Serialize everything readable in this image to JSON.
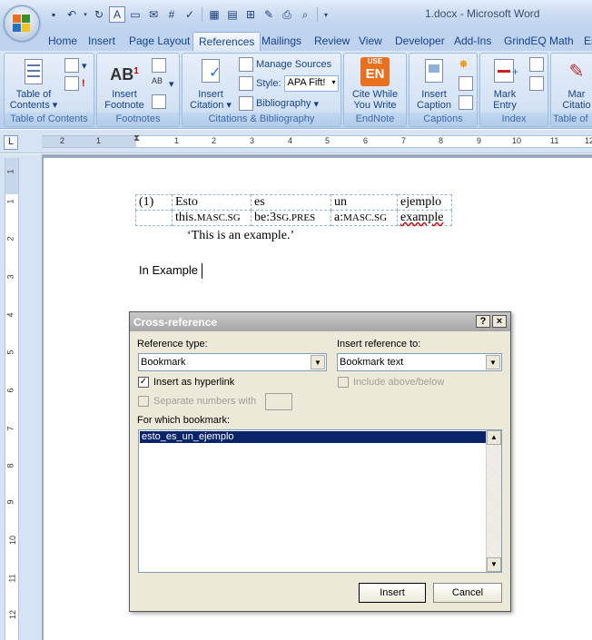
{
  "window": {
    "title": "1.docx - Microsoft Word"
  },
  "tabs": [
    "Home",
    "Insert",
    "Page Layout",
    "References",
    "Mailings",
    "Review",
    "View",
    "Developer",
    "Add-Ins",
    "GrindEQ Math",
    "En"
  ],
  "active_tab": "References",
  "ribbon": {
    "toc": {
      "button": "Table of Contents",
      "group": "Table of Contents"
    },
    "footnotes": {
      "button": "Insert Footnote",
      "group": "Footnotes"
    },
    "citations": {
      "insert_citation": "Insert Citation",
      "manage_sources": "Manage Sources",
      "style_label": "Style:",
      "style_value": "APA Fift!",
      "bibliography": "Bibliography",
      "group": "Citations & Bibliography"
    },
    "endnote": {
      "logo_top": "USE",
      "logo_bottom": "EN",
      "button": "Cite While You Write",
      "group": "EndNote"
    },
    "captions": {
      "button": "Insert Caption",
      "group": "Captions"
    },
    "index": {
      "button": "Mark Entry",
      "group": "Index"
    },
    "toa": {
      "button": "Mar Citatio",
      "group": "Table of"
    }
  },
  "ruler": {
    "tab_selector": "L",
    "numbers": [
      "2",
      "1",
      "1",
      "2",
      "3",
      "4",
      "5",
      "6",
      "7",
      "8",
      "9",
      "10",
      "11",
      "12"
    ],
    "vnumbers": [
      "1",
      "1",
      "2",
      "3",
      "4",
      "5",
      "6",
      "7",
      "8",
      "9",
      "10",
      "11",
      "12"
    ]
  },
  "document": {
    "example_number": "(1)",
    "gloss_row1": [
      "Esto",
      "es",
      "un",
      "ejemplo"
    ],
    "gloss_row2": [
      {
        "main": "this.",
        "sc": "MASC.SG"
      },
      {
        "main": "be:3",
        "sc": "SG.PRES"
      },
      {
        "main": "a:",
        "sc": "MASC.SG"
      },
      {
        "main": "example",
        "sc": ""
      }
    ],
    "translation": "‘This is an example.’",
    "paragraph": "In Example"
  },
  "dialog": {
    "title": "Cross-reference",
    "help": "?",
    "close": "×",
    "reference_type_label": "Reference type:",
    "reference_type_value": "Bookmark",
    "insert_reference_to_label": "Insert reference to:",
    "insert_reference_to_value": "Bookmark text",
    "insert_as_hyperlink": "Insert as hyperlink",
    "include_above_below": "Include above/below",
    "separate_numbers_with": "Separate numbers with",
    "for_which_label": "For which bookmark:",
    "bookmarks": [
      "esto_es_un_ejemplo"
    ],
    "insert_button": "Insert",
    "cancel_button": "Cancel"
  }
}
